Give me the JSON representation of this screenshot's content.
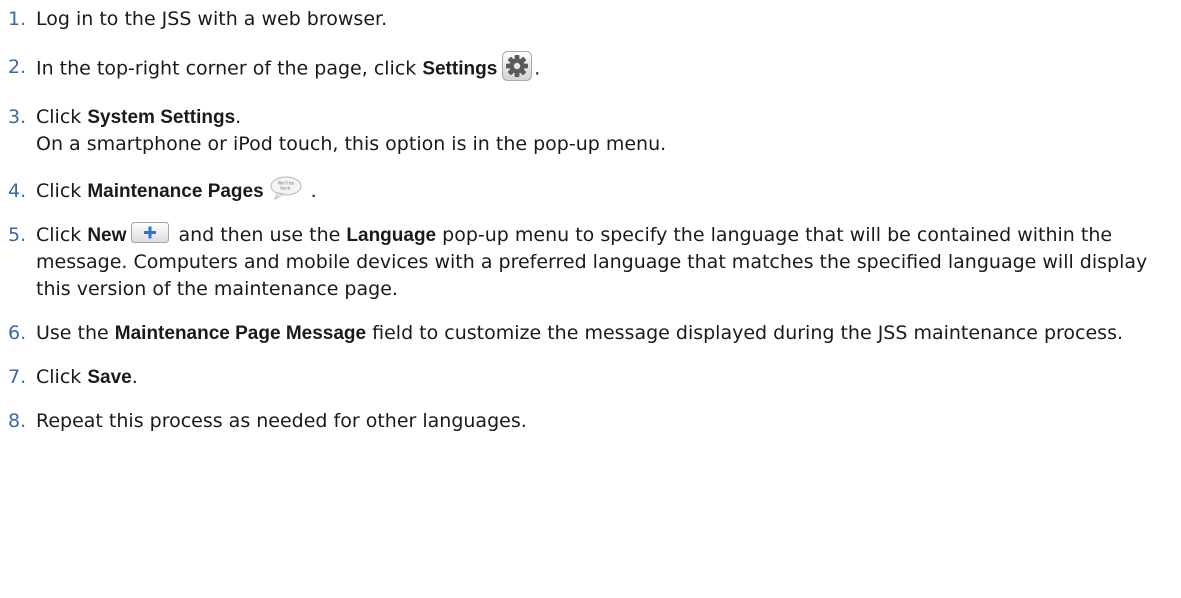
{
  "steps": [
    {
      "number": "1",
      "text": "Log in to the JSS with a web browser."
    },
    {
      "number": "2",
      "prefix": "In the top-right corner of the page, click ",
      "bold": "Settings",
      "icon": "settings-gear-icon",
      "suffix": "."
    },
    {
      "number": "3",
      "prefix": "Click ",
      "bold": "System Settings",
      "suffix": ".",
      "note": "On a smartphone or iPod touch, this option is in the pop-up menu."
    },
    {
      "number": "4",
      "prefix": "Click ",
      "bold": "Maintenance Pages",
      "icon": "maintenance-pages-icon",
      "icon_text_line1": "We'll be",
      "icon_text_line2": "back.",
      "suffix": "."
    },
    {
      "number": "5",
      "prefix": "Click ",
      "bold": "New",
      "icon": "plus-icon",
      "middle": " and then use the ",
      "bold2": "Language",
      "suffix": " pop-up menu to specify the language that will be contained within the message. Computers and mobile devices with a preferred language that matches the specified language will display this version of the maintenance page."
    },
    {
      "number": "6",
      "prefix": "Use the ",
      "bold": "Maintenance Page Message",
      "suffix": " field to customize the message displayed during the JSS maintenance process."
    },
    {
      "number": "7",
      "prefix": "Click ",
      "bold": "Save",
      "suffix": "."
    },
    {
      "number": "8",
      "text": "Repeat this process as needed for other languages."
    }
  ],
  "colors": {
    "step_number": "#3b6aa0",
    "text": "#1a1a1a",
    "new_button_plus": "#2f74c9"
  }
}
